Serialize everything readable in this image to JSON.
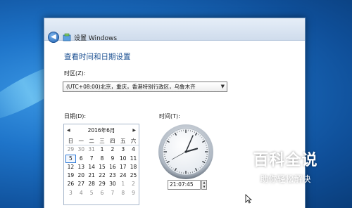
{
  "window": {
    "title": "设置 Windows",
    "heading": "查看时间和日期设置"
  },
  "timezone": {
    "label": "时区(Z):",
    "value": "(UTC+08:00)北京，重庆，香港特别行政区，乌鲁木齐"
  },
  "date": {
    "label": "日期(D):",
    "month_title": "2016年6月",
    "weekdays": [
      "日",
      "一",
      "二",
      "三",
      "四",
      "五",
      "六"
    ],
    "weeks": [
      [
        "29",
        "30",
        "31",
        "1",
        "2",
        "3",
        "4"
      ],
      [
        "5",
        "6",
        "7",
        "8",
        "9",
        "10",
        "11"
      ],
      [
        "12",
        "13",
        "14",
        "15",
        "16",
        "17",
        "18"
      ],
      [
        "19",
        "20",
        "21",
        "22",
        "23",
        "24",
        "25"
      ],
      [
        "26",
        "27",
        "28",
        "29",
        "30",
        "1",
        "2"
      ],
      [
        "3",
        "4",
        "5",
        "6",
        "7",
        "8",
        "9"
      ]
    ],
    "selected_day": "5"
  },
  "time": {
    "label": "时间(T):",
    "value": "21:07:45"
  },
  "watermark": {
    "title": "百科全说",
    "subtitle": "助你轻松解决"
  },
  "colors": {
    "heading": "#1a4f91",
    "selected_border": "#2f7ad6"
  }
}
